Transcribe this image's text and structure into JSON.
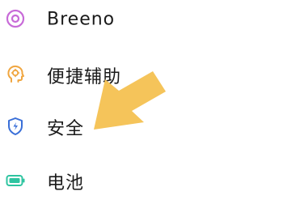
{
  "settings_list": {
    "items": [
      {
        "id": "breeno",
        "label": "Breeno",
        "icon": "breeno-icon",
        "color": "#c86bd8"
      },
      {
        "id": "assist",
        "label": "便捷辅助",
        "icon": "assist-head-icon",
        "color": "#f0a640"
      },
      {
        "id": "security",
        "label": "安全",
        "icon": "shield-icon",
        "color": "#3a6fd8"
      },
      {
        "id": "battery",
        "label": "电池",
        "icon": "battery-icon",
        "color": "#2ec4a0"
      }
    ]
  },
  "annotation": {
    "arrow_color": "#f5c45a"
  }
}
